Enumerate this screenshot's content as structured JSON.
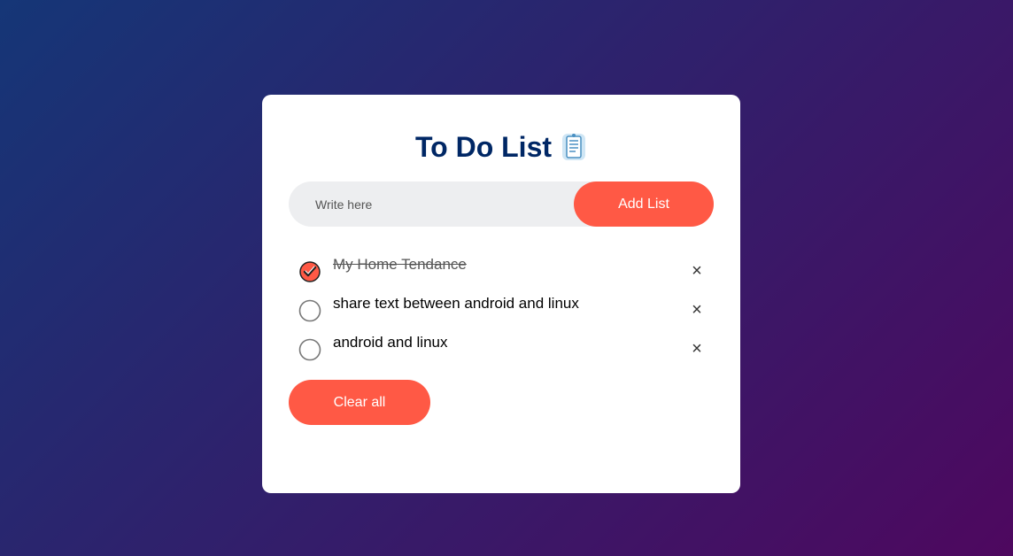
{
  "app": {
    "title": "To Do List",
    "title_icon": "notepad-icon"
  },
  "input": {
    "placeholder": "Write here",
    "value": ""
  },
  "add_button": {
    "label": "Add List"
  },
  "tasks": [
    {
      "text": "My Home Tendance",
      "checked": true
    },
    {
      "text": "share text between android and linux",
      "checked": false
    },
    {
      "text": "android and linux",
      "checked": false
    }
  ],
  "remove_label": "×",
  "clear_button": {
    "label": "Clear all"
  },
  "colors": {
    "accent": "#ff5945",
    "title": "#002765",
    "input_bg": "#edeef0",
    "gradient_start": "#153677",
    "gradient_end": "#4e085f"
  }
}
